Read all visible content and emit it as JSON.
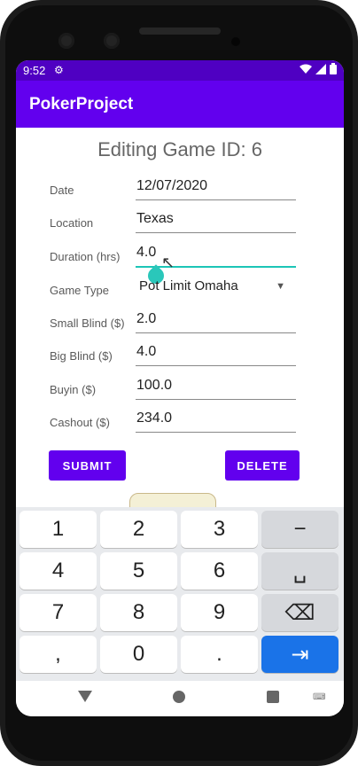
{
  "status": {
    "time": "9:52"
  },
  "app": {
    "title": "PokerProject"
  },
  "form": {
    "title": "Editing Game ID: 6",
    "fields": [
      {
        "label": "Date",
        "value": "12/07/2020"
      },
      {
        "label": "Location",
        "value": "Texas"
      },
      {
        "label": "Duration (hrs)",
        "value": "4.0"
      },
      {
        "label": "Game Type",
        "value": "Pot Limit Omaha"
      },
      {
        "label": "Small Blind ($)",
        "value": "2.0"
      },
      {
        "label": "Big Blind ($)",
        "value": "4.0"
      },
      {
        "label": "Buyin ($)",
        "value": "100.0"
      },
      {
        "label": "Cashout ($)",
        "value": "234.0"
      }
    ],
    "submit_label": "SUBMIT",
    "delete_label": "DELETE"
  },
  "keyboard": {
    "keys": [
      "1",
      "2",
      "3",
      "−",
      "4",
      "5",
      "6",
      "␣",
      "7",
      "8",
      "9",
      "⌫",
      ",",
      "0",
      ".",
      "⇥"
    ]
  },
  "colors": {
    "primary": "#6200ee",
    "status": "#4f00c2",
    "accent": "#1cc5b7",
    "key_action": "#1a73e8"
  },
  "icons": {
    "settings": "gear-icon",
    "wifi": "wifi-icon",
    "signal": "signal-icon",
    "battery": "battery-icon"
  }
}
